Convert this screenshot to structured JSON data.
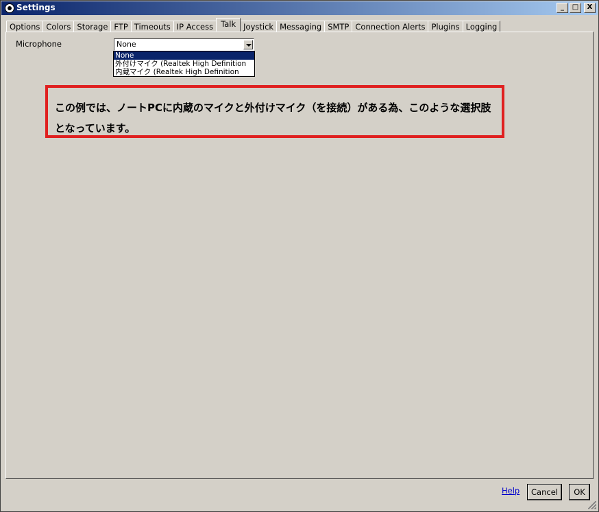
{
  "window": {
    "title": "Settings",
    "controls": {
      "minimize": "_",
      "maximize": "□",
      "close": "X"
    }
  },
  "tabs": [
    {
      "label": "Options",
      "active": false
    },
    {
      "label": "Colors",
      "active": false
    },
    {
      "label": "Storage",
      "active": false
    },
    {
      "label": "FTP",
      "active": false
    },
    {
      "label": "Timeouts",
      "active": false
    },
    {
      "label": "IP Access",
      "active": false
    },
    {
      "label": "Talk",
      "active": true
    },
    {
      "label": "Joystick",
      "active": false
    },
    {
      "label": "Messaging",
      "active": false
    },
    {
      "label": "SMTP",
      "active": false
    },
    {
      "label": "Connection Alerts",
      "active": false
    },
    {
      "label": "Plugins",
      "active": false
    },
    {
      "label": "Logging",
      "active": false
    }
  ],
  "talk": {
    "microphone_label": "Microphone",
    "microphone_value": "None",
    "options": [
      {
        "label": "None",
        "selected": true
      },
      {
        "label": "外付けマイク (Realtek High Definition",
        "selected": false
      },
      {
        "label": "内蔵マイク (Realtek High Definition",
        "selected": false
      }
    ]
  },
  "callout": {
    "text": "この例では、ノートPCに内蔵のマイクと外付けマイク（を接続）がある為、このような選択肢となっています。",
    "color": "#e02020"
  },
  "footer": {
    "help_link": "Help",
    "cancel_label": "Cancel",
    "ok_label": "OK"
  }
}
